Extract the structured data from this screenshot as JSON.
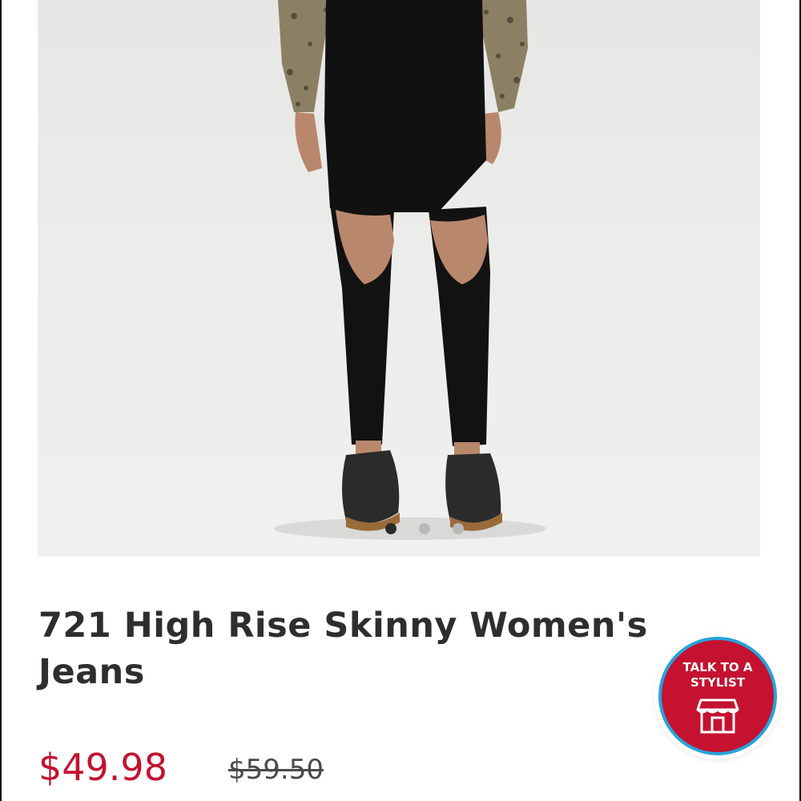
{
  "product": {
    "title": "721 High Rise Skinny Women's Jeans",
    "price_sale": "$49.98",
    "price_original": "$59.50"
  },
  "gallery": {
    "image_icon": "jeans-photo",
    "dot_count": 3,
    "active_index": 0
  },
  "stylist": {
    "label": "TALK TO A STYLIST",
    "icon": "store-icon"
  },
  "colors": {
    "price_sale": "#c41230",
    "stylist_bg": "#c41230",
    "stylist_ring": "#26a3dd",
    "title": "#2e2e2e"
  }
}
